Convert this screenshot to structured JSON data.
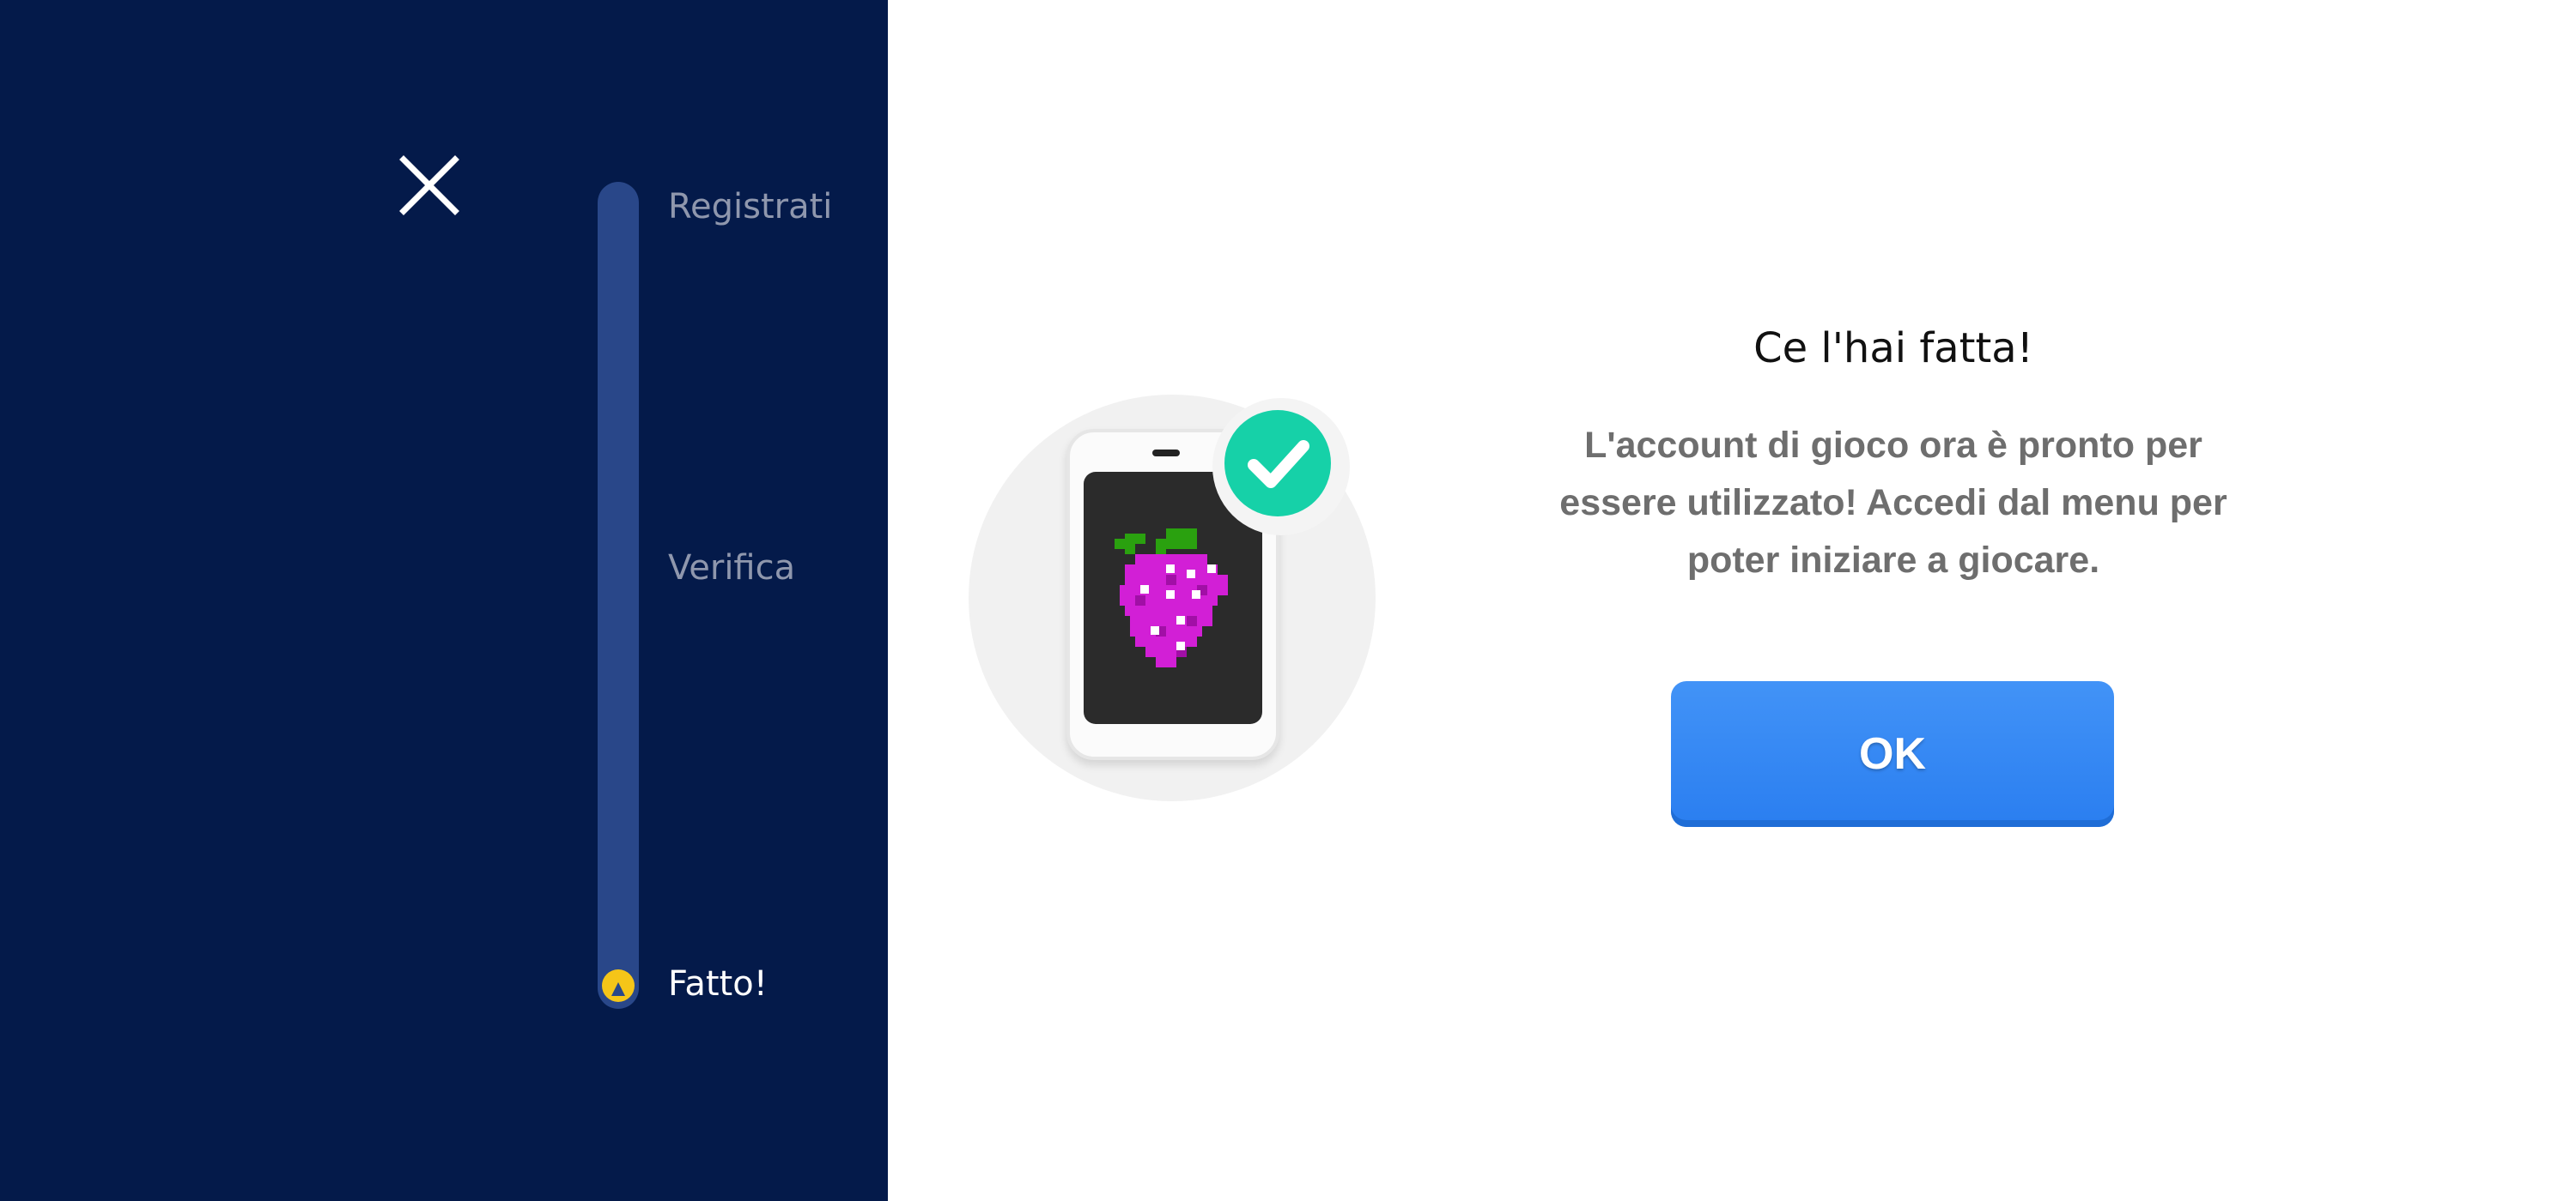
{
  "sidebar": {
    "close_icon": "close-icon",
    "steps": [
      {
        "label": "Registrati",
        "state": "inactive"
      },
      {
        "label": "Verifica",
        "state": "inactive"
      },
      {
        "label": "Fatto!",
        "state": "active"
      }
    ],
    "progress_step": 3,
    "progress_total": 3
  },
  "illustration": {
    "icon": "phone-with-grapes-icon",
    "badge_icon": "checkmark-icon"
  },
  "dialog": {
    "title": "Ce l'hai fatta!",
    "message": "L'account di gioco ora è pronto per essere utilizzato! Accedi dal menu per poter iniziare a giocare.",
    "ok_label": "OK"
  },
  "colors": {
    "sidebar_bg": "#041a4a",
    "track": "#294789",
    "progress_marker": "#f5c518",
    "check_badge": "#16d1a8",
    "ok_button": "#2e84f3",
    "grape": "#d21fd6",
    "leaf": "#2aa10f"
  }
}
